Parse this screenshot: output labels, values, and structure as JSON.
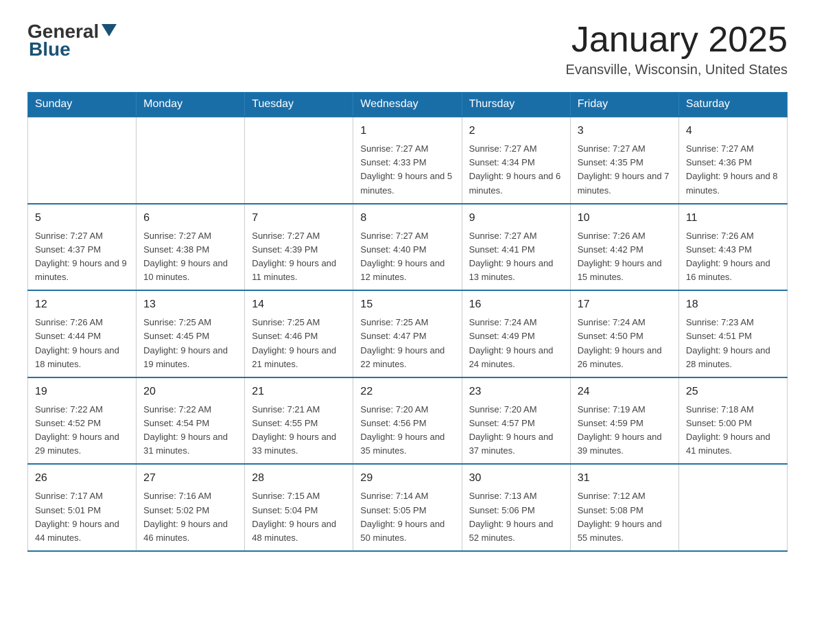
{
  "logo": {
    "general": "General",
    "blue": "Blue"
  },
  "title": "January 2025",
  "subtitle": "Evansville, Wisconsin, United States",
  "days_of_week": [
    "Sunday",
    "Monday",
    "Tuesday",
    "Wednesday",
    "Thursday",
    "Friday",
    "Saturday"
  ],
  "weeks": [
    [
      {
        "day": "",
        "info": ""
      },
      {
        "day": "",
        "info": ""
      },
      {
        "day": "",
        "info": ""
      },
      {
        "day": "1",
        "info": "Sunrise: 7:27 AM\nSunset: 4:33 PM\nDaylight: 9 hours and 5 minutes."
      },
      {
        "day": "2",
        "info": "Sunrise: 7:27 AM\nSunset: 4:34 PM\nDaylight: 9 hours and 6 minutes."
      },
      {
        "day": "3",
        "info": "Sunrise: 7:27 AM\nSunset: 4:35 PM\nDaylight: 9 hours and 7 minutes."
      },
      {
        "day": "4",
        "info": "Sunrise: 7:27 AM\nSunset: 4:36 PM\nDaylight: 9 hours and 8 minutes."
      }
    ],
    [
      {
        "day": "5",
        "info": "Sunrise: 7:27 AM\nSunset: 4:37 PM\nDaylight: 9 hours and 9 minutes."
      },
      {
        "day": "6",
        "info": "Sunrise: 7:27 AM\nSunset: 4:38 PM\nDaylight: 9 hours and 10 minutes."
      },
      {
        "day": "7",
        "info": "Sunrise: 7:27 AM\nSunset: 4:39 PM\nDaylight: 9 hours and 11 minutes."
      },
      {
        "day": "8",
        "info": "Sunrise: 7:27 AM\nSunset: 4:40 PM\nDaylight: 9 hours and 12 minutes."
      },
      {
        "day": "9",
        "info": "Sunrise: 7:27 AM\nSunset: 4:41 PM\nDaylight: 9 hours and 13 minutes."
      },
      {
        "day": "10",
        "info": "Sunrise: 7:26 AM\nSunset: 4:42 PM\nDaylight: 9 hours and 15 minutes."
      },
      {
        "day": "11",
        "info": "Sunrise: 7:26 AM\nSunset: 4:43 PM\nDaylight: 9 hours and 16 minutes."
      }
    ],
    [
      {
        "day": "12",
        "info": "Sunrise: 7:26 AM\nSunset: 4:44 PM\nDaylight: 9 hours and 18 minutes."
      },
      {
        "day": "13",
        "info": "Sunrise: 7:25 AM\nSunset: 4:45 PM\nDaylight: 9 hours and 19 minutes."
      },
      {
        "day": "14",
        "info": "Sunrise: 7:25 AM\nSunset: 4:46 PM\nDaylight: 9 hours and 21 minutes."
      },
      {
        "day": "15",
        "info": "Sunrise: 7:25 AM\nSunset: 4:47 PM\nDaylight: 9 hours and 22 minutes."
      },
      {
        "day": "16",
        "info": "Sunrise: 7:24 AM\nSunset: 4:49 PM\nDaylight: 9 hours and 24 minutes."
      },
      {
        "day": "17",
        "info": "Sunrise: 7:24 AM\nSunset: 4:50 PM\nDaylight: 9 hours and 26 minutes."
      },
      {
        "day": "18",
        "info": "Sunrise: 7:23 AM\nSunset: 4:51 PM\nDaylight: 9 hours and 28 minutes."
      }
    ],
    [
      {
        "day": "19",
        "info": "Sunrise: 7:22 AM\nSunset: 4:52 PM\nDaylight: 9 hours and 29 minutes."
      },
      {
        "day": "20",
        "info": "Sunrise: 7:22 AM\nSunset: 4:54 PM\nDaylight: 9 hours and 31 minutes."
      },
      {
        "day": "21",
        "info": "Sunrise: 7:21 AM\nSunset: 4:55 PM\nDaylight: 9 hours and 33 minutes."
      },
      {
        "day": "22",
        "info": "Sunrise: 7:20 AM\nSunset: 4:56 PM\nDaylight: 9 hours and 35 minutes."
      },
      {
        "day": "23",
        "info": "Sunrise: 7:20 AM\nSunset: 4:57 PM\nDaylight: 9 hours and 37 minutes."
      },
      {
        "day": "24",
        "info": "Sunrise: 7:19 AM\nSunset: 4:59 PM\nDaylight: 9 hours and 39 minutes."
      },
      {
        "day": "25",
        "info": "Sunrise: 7:18 AM\nSunset: 5:00 PM\nDaylight: 9 hours and 41 minutes."
      }
    ],
    [
      {
        "day": "26",
        "info": "Sunrise: 7:17 AM\nSunset: 5:01 PM\nDaylight: 9 hours and 44 minutes."
      },
      {
        "day": "27",
        "info": "Sunrise: 7:16 AM\nSunset: 5:02 PM\nDaylight: 9 hours and 46 minutes."
      },
      {
        "day": "28",
        "info": "Sunrise: 7:15 AM\nSunset: 5:04 PM\nDaylight: 9 hours and 48 minutes."
      },
      {
        "day": "29",
        "info": "Sunrise: 7:14 AM\nSunset: 5:05 PM\nDaylight: 9 hours and 50 minutes."
      },
      {
        "day": "30",
        "info": "Sunrise: 7:13 AM\nSunset: 5:06 PM\nDaylight: 9 hours and 52 minutes."
      },
      {
        "day": "31",
        "info": "Sunrise: 7:12 AM\nSunset: 5:08 PM\nDaylight: 9 hours and 55 minutes."
      },
      {
        "day": "",
        "info": ""
      }
    ]
  ]
}
